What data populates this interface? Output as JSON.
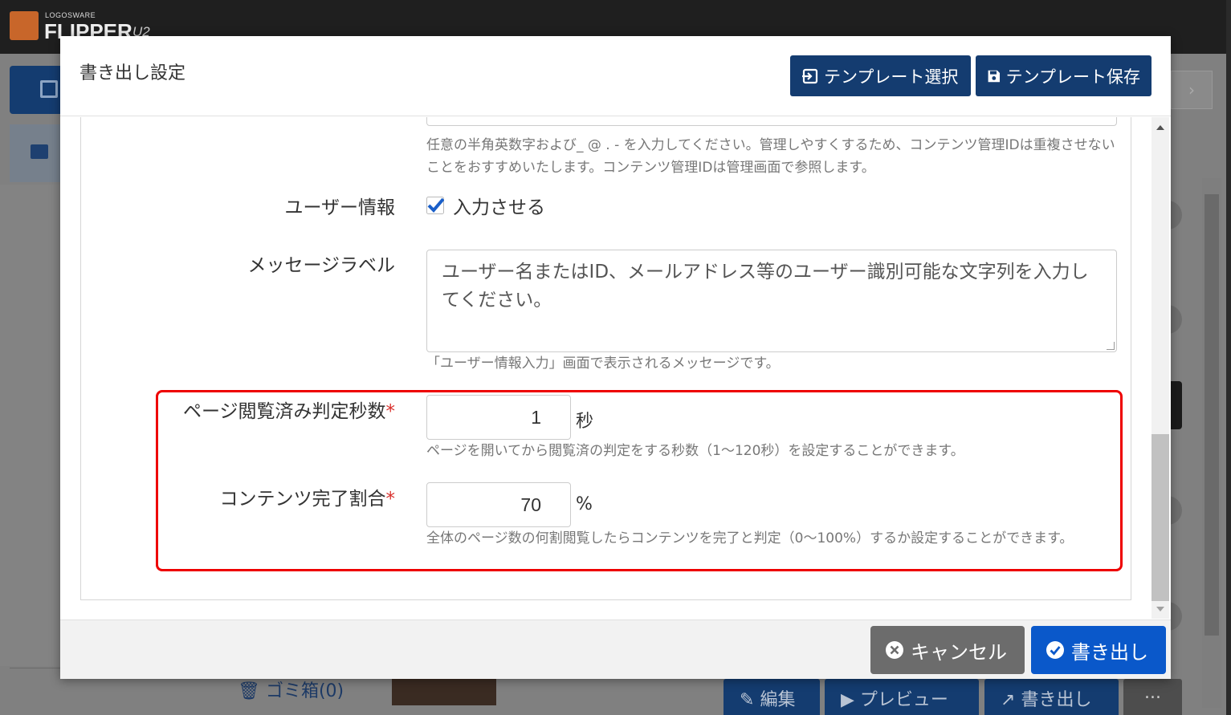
{
  "app": {
    "brand_sub": "LOGOSWARE",
    "brand_main": "FLIPPER",
    "brand_ver": "U2",
    "trash_label": "ゴミ箱(0)",
    "bottom_buttons": [
      "編集",
      "プレビュー",
      "書き出し"
    ],
    "more_label": "..."
  },
  "modal": {
    "title": "書き出し設定",
    "template_select_label": "テンプレート選択",
    "template_save_label": "テンプレート保存",
    "content_id_help": "任意の半角英数字および_ @ . - を入力してください。管理しやすくするため、コンテンツ管理IDは重複させないことをおすすめいたします。コンテンツ管理IDは管理画面で参照します。",
    "user_info": {
      "label": "ユーザー情報",
      "checkbox_label": "入力させる",
      "checked": true
    },
    "message_label": {
      "label": "メッセージラベル",
      "value": "ユーザー名またはID、メールアドレス等のユーザー識別可能な文字列を入力してください。",
      "help": "「ユーザー情報入力」画面で表示されるメッセージです。"
    },
    "page_read_seconds": {
      "label": "ページ閲覧済み判定秒数",
      "required_mark": "*",
      "value": "1",
      "unit": "秒",
      "help": "ページを開いてから閲覧済の判定をする秒数（1〜120秒）を設定することができます。"
    },
    "completion_ratio": {
      "label": "コンテンツ完了割合",
      "required_mark": "*",
      "value": "70",
      "unit": "%",
      "help": "全体のページ数の何割閲覧したらコンテンツを完了と判定（0〜100%）するか設定することができます。"
    },
    "cancel_label": "キャンセル",
    "export_label": "書き出し"
  },
  "colors": {
    "primary": "#143c70",
    "footer_primary": "#0a58ca",
    "cancel": "#6c6c6c",
    "required": "#d9302c",
    "highlight": "#e00000",
    "checkbox": "#1a5fc9"
  }
}
